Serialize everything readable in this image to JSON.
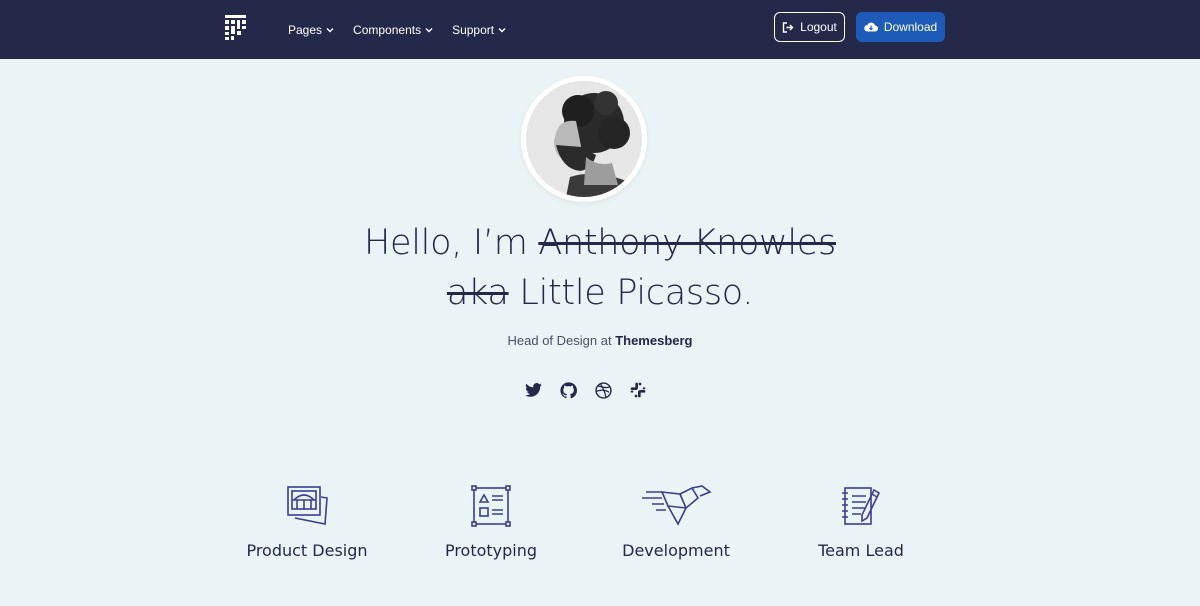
{
  "nav": {
    "items": [
      {
        "label": "Pages"
      },
      {
        "label": "Components"
      },
      {
        "label": "Support"
      }
    ],
    "logout_label": "Logout",
    "download_label": "Download"
  },
  "hero": {
    "greeting": "Hello, I’m ",
    "struck_name": "Anthony Knowles",
    "struck_aka": "aka",
    "nickname": " Little Picasso.",
    "subtitle_prefix": "Head of Design at ",
    "company": "Themesberg"
  },
  "socials": [
    "twitter-icon",
    "github-icon",
    "dribbble-icon",
    "slack-icon"
  ],
  "features": [
    {
      "label": "Product Design",
      "icon": "product-design-icon"
    },
    {
      "label": "Prototyping",
      "icon": "prototyping-icon"
    },
    {
      "label": "Development",
      "icon": "development-icon"
    },
    {
      "label": "Team Lead",
      "icon": "team-lead-icon"
    }
  ],
  "colors": {
    "nav_bg": "#24294a",
    "page_bg": "#eaf3f5",
    "primary_button": "#1e5bb8",
    "icon_accent": "#3b3f8f"
  }
}
